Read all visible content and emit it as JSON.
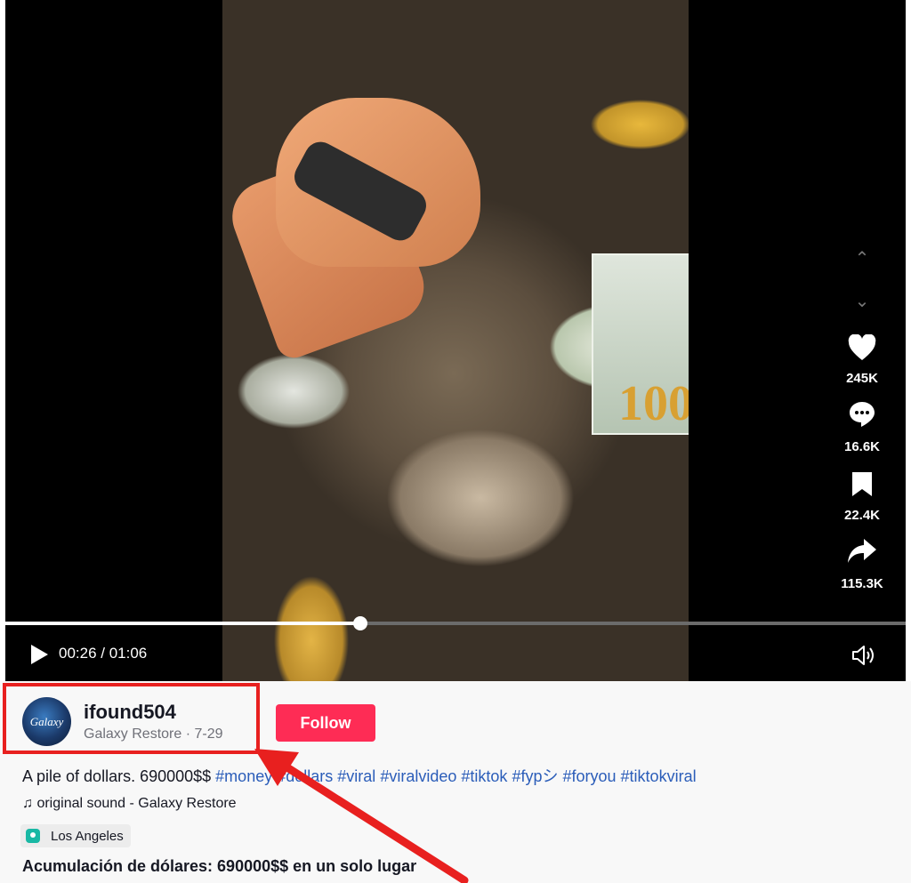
{
  "player": {
    "current_time": "00:26",
    "duration": "01:06",
    "time_separator": " / ",
    "progress_fraction": 0.394,
    "bill_number": "100"
  },
  "actions": {
    "likes": "245K",
    "comments": "16.6K",
    "bookmarks": "22.4K",
    "shares": "115.3K"
  },
  "author": {
    "avatar_text": "Galaxy",
    "username": "ifound504",
    "display_name": "Galaxy Restore",
    "date": "7-29",
    "follow_label": "Follow"
  },
  "post": {
    "caption_text": "A pile of dollars. 690000$$ ",
    "hashtags": [
      "#money",
      "#dollars",
      "#viral",
      "#viralvideo",
      "#tiktok",
      "#fypシ",
      "#foryou",
      "#tiktokviral"
    ],
    "sound_label": "original sound - Galaxy Restore",
    "location": "Los Angeles",
    "secondary_title": "Acumulación de dólares: 690000$$ en un solo lugar"
  },
  "colors": {
    "follow_button": "#fe2c55",
    "hashtag": "#2b5db9",
    "annotation_red": "#e8201f",
    "location_icon": "#19b8a4"
  }
}
